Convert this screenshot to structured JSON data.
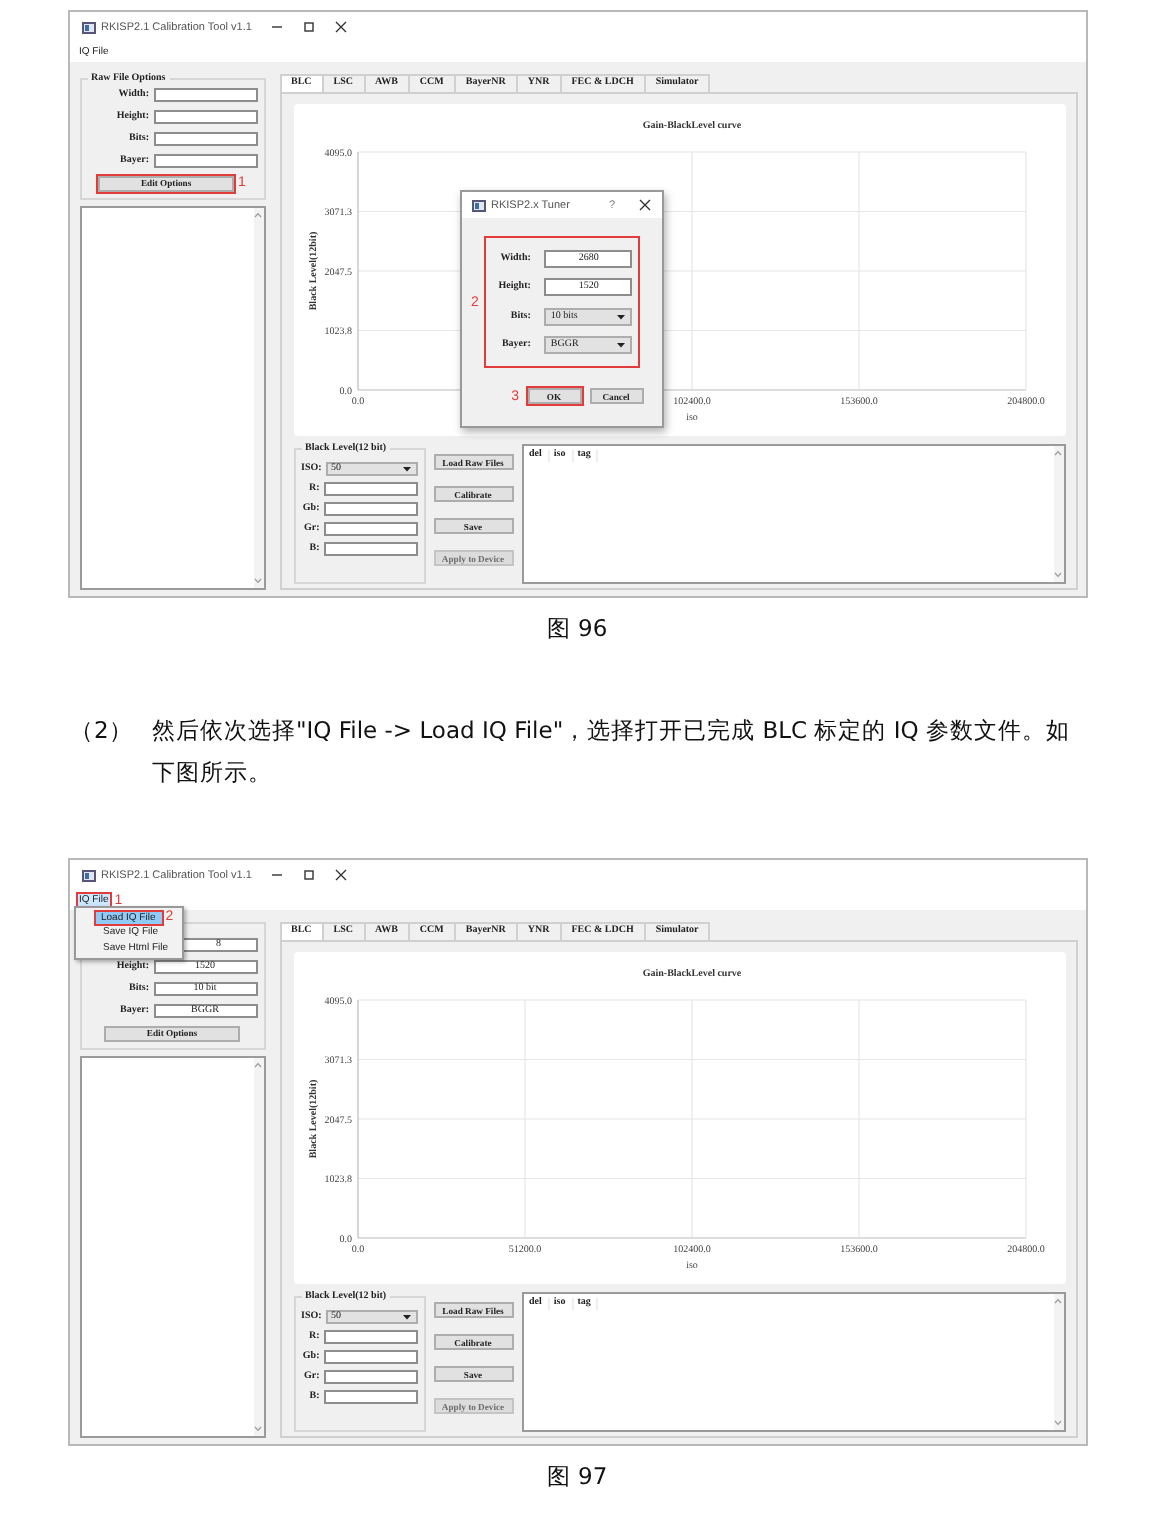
{
  "blocks": [
    {
      "kind": "screenshot",
      "window": {
        "title": "RKISP2.1 Calibration Tool v1.1"
      },
      "menu": [
        {
          "label": "IQ File",
          "selected": false
        }
      ],
      "raw_file_options": {
        "title": "Raw File Options",
        "fields": [
          {
            "label": "Width:"
          },
          {
            "label": "Height:"
          },
          {
            "label": "Bits:"
          },
          {
            "label": "Bayer:"
          }
        ],
        "button": {
          "label": "Edit Options",
          "annotation": "1"
        }
      },
      "tabs": [
        {
          "label": "BLC",
          "selected": true
        },
        {
          "label": "LSC",
          "selected": false
        },
        {
          "label": "AWB",
          "selected": false
        },
        {
          "label": "CCM",
          "selected": false
        },
        {
          "label": "BayerNR",
          "selected": false
        },
        {
          "label": "YNR",
          "selected": false
        },
        {
          "label": "FEC & LDCH",
          "selected": false
        },
        {
          "label": "Simulator",
          "selected": false
        }
      ],
      "chart_data": {
        "type": "line",
        "grid": true,
        "title": "Gain-BlackLevel curve",
        "xlabel": "iso",
        "ylabel": "Black Level(12bit)",
        "xlim": [
          0,
          204800
        ],
        "ylim": [
          0,
          4095
        ],
        "xticks": [
          {
            "value": 0,
            "label": "0.0"
          },
          {
            "value": 102400,
            "label": "102400.0"
          },
          {
            "value": 153600,
            "label": "153600.0"
          },
          {
            "value": 204800,
            "label": "204800.0"
          }
        ],
        "yticks": [
          {
            "value": 0,
            "label": "0.0"
          },
          {
            "value": 1023.75,
            "label": "1023.8"
          },
          {
            "value": 2047.5,
            "label": "2047.5"
          },
          {
            "value": 3071.25,
            "label": "3071.3"
          },
          {
            "value": 4095,
            "label": "4095.0"
          }
        ]
      },
      "black_level": {
        "title": "Black Level(12 bit)",
        "iso": {
          "label": "ISO:",
          "value": "50"
        },
        "fields": [
          {
            "label": "R:"
          },
          {
            "label": "Gb:"
          },
          {
            "label": "Gr:"
          },
          {
            "label": "B:"
          }
        ]
      },
      "buttons": [
        {
          "label": "Load Raw Files",
          "disabled": false
        },
        {
          "label": "Calibrate",
          "disabled": false
        },
        {
          "label": "Save",
          "disabled": false
        },
        {
          "label": "Apply to Device",
          "disabled": true
        }
      ],
      "table": {
        "columns": [
          "del",
          "iso",
          "tag"
        ]
      },
      "dialog": {
        "title": "RKISP2.x Tuner",
        "help": "?",
        "annotation": "2",
        "fields": [
          {
            "kind": "text",
            "label": "Width:",
            "value": "2680"
          },
          {
            "kind": "text",
            "label": "Height:",
            "value": "1520"
          },
          {
            "kind": "dropdown",
            "label": "Bits:",
            "value": "10 bits"
          },
          {
            "kind": "dropdown",
            "label": "Bayer:",
            "value": "BGGR"
          }
        ],
        "buttons": [
          {
            "label": "OK",
            "annotation": "3"
          },
          {
            "label": "Cancel"
          }
        ]
      }
    },
    {
      "kind": "caption",
      "text": "图 96"
    },
    {
      "kind": "paragraph",
      "number": "（2）",
      "text": "然后依次选择\"IQ File -> Load IQ File\"，选择打开已完成 BLC 标定的 IQ 参数文件。如下图所示。"
    },
    {
      "kind": "screenshot",
      "window": {
        "title": "RKISP2.1 Calibration Tool v1.1"
      },
      "menu": [
        {
          "label": "IQ File",
          "annotation": "1",
          "open": true,
          "selected": true,
          "items": [
            {
              "label": "Load IQ File",
              "selected": true,
              "annotation": "2"
            },
            {
              "label": "Save IQ File",
              "selected": false
            },
            {
              "label": "Save Html File",
              "selected": false
            }
          ]
        }
      ],
      "raw_file_options": {
        "fields": [
          {
            "value": "8"
          },
          {
            "label": "Height:",
            "value": "1520"
          },
          {
            "label": "Bits:",
            "value": "10 bit"
          },
          {
            "label": "Bayer:",
            "value": "BGGR"
          }
        ],
        "button": {
          "label": "Edit Options"
        }
      },
      "tabs": [
        {
          "label": "BLC",
          "selected": true
        },
        {
          "label": "LSC",
          "selected": false
        },
        {
          "label": "AWB",
          "selected": false
        },
        {
          "label": "CCM",
          "selected": false
        },
        {
          "label": "BayerNR",
          "selected": false
        },
        {
          "label": "YNR",
          "selected": false
        },
        {
          "label": "FEC & LDCH",
          "selected": false
        },
        {
          "label": "Simulator",
          "selected": false
        }
      ],
      "chart_data": {
        "type": "line",
        "grid": true,
        "title": "Gain-BlackLevel curve",
        "xlabel": "iso",
        "ylabel": "Black Level(12bit)",
        "xlim": [
          0,
          204800
        ],
        "ylim": [
          0,
          4095
        ],
        "xticks": [
          {
            "value": 0,
            "label": "0.0"
          },
          {
            "value": 51200,
            "label": "51200.0"
          },
          {
            "value": 102400,
            "label": "102400.0"
          },
          {
            "value": 153600,
            "label": "153600.0"
          },
          {
            "value": 204800,
            "label": "204800.0"
          }
        ],
        "yticks": [
          {
            "value": 0,
            "label": "0.0"
          },
          {
            "value": 1023.75,
            "label": "1023.8"
          },
          {
            "value": 2047.5,
            "label": "2047.5"
          },
          {
            "value": 3071.25,
            "label": "3071.3"
          },
          {
            "value": 4095,
            "label": "4095.0"
          }
        ]
      },
      "black_level": {
        "title": "Black Level(12 bit)",
        "iso": {
          "label": "ISO:",
          "value": "50"
        },
        "fields": [
          {
            "label": "R:"
          },
          {
            "label": "Gb:"
          },
          {
            "label": "Gr:"
          },
          {
            "label": "B:"
          }
        ]
      },
      "buttons": [
        {
          "label": "Load Raw Files",
          "disabled": false
        },
        {
          "label": "Calibrate",
          "disabled": false
        },
        {
          "label": "Save",
          "disabled": false
        },
        {
          "label": "Apply to Device",
          "disabled": true
        }
      ],
      "table": {
        "columns": [
          "del",
          "iso",
          "tag"
        ]
      }
    },
    {
      "kind": "caption",
      "text": "图 97"
    }
  ]
}
